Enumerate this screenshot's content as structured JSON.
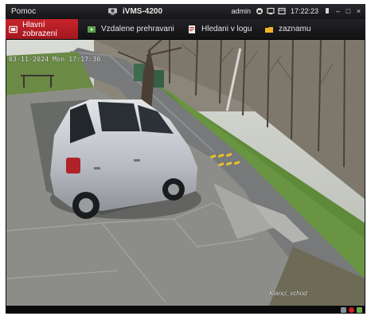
{
  "titlebar": {
    "menu_label": "Pomoc",
    "app_title": "iVMS-4200",
    "user": "admin",
    "clock": "17:22:23"
  },
  "tabs": [
    {
      "label": "Hlavní zobrazení",
      "icon": "main-view-icon",
      "active": true
    },
    {
      "label": "Vzdalene prehravani",
      "icon": "remote-playback-icon",
      "active": false
    },
    {
      "label": "Hledani v logu",
      "icon": "log-search-icon",
      "active": false
    },
    {
      "label": "zaznamu",
      "icon": "record-icon",
      "active": false
    }
  ],
  "video": {
    "osd_timestamp": "03-11-2024 Mon 17:17:30",
    "osd_camera_name": "Klanci_vchod"
  },
  "colors": {
    "active_tab": "#b81e26",
    "window_bg": "#0d0d0f",
    "record_indicator": "#d22222"
  }
}
